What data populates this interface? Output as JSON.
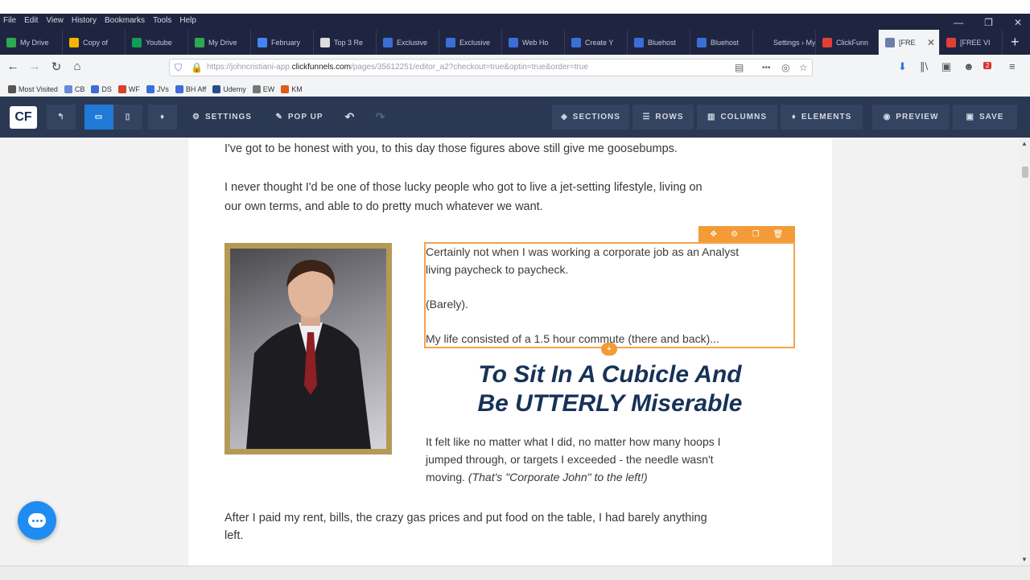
{
  "menu": [
    "File",
    "Edit",
    "View",
    "History",
    "Bookmarks",
    "Tools",
    "Help"
  ],
  "window_controls": [
    "—",
    "❐",
    "✕"
  ],
  "tabs": [
    {
      "label": "My Drive",
      "color": "#2fa84f"
    },
    {
      "label": "Copy of",
      "color": "#f4b400"
    },
    {
      "label": "Youtube",
      "color": "#0f9d58"
    },
    {
      "label": "My Drive",
      "color": "#2fa84f"
    },
    {
      "label": "February",
      "color": "#4285f4"
    },
    {
      "label": "Top 3 Re",
      "color": "#dddddd"
    },
    {
      "label": "Exclusive",
      "color": "#3b6fd8"
    },
    {
      "label": "Exclusive",
      "color": "#3b6fd8"
    },
    {
      "label": "Web Ho",
      "color": "#3b6fd8"
    },
    {
      "label": "Create Y",
      "color": "#3b6fd8"
    },
    {
      "label": "Bluehost",
      "color": "#3b6fd8"
    },
    {
      "label": "Bluehost",
      "color": "#3b6fd8"
    },
    {
      "label": "Settings › My",
      "color": "#1f2540"
    },
    {
      "label": "ClickFunn",
      "color": "#e0403a"
    },
    {
      "label": "[FRE",
      "color": "#6b7fa8",
      "active": true
    },
    {
      "label": "[FREE VI",
      "color": "#e0403a"
    }
  ],
  "tab_close": "✕",
  "tab_new": "+",
  "navbar": {
    "back": "←",
    "forward": "→",
    "reload": "↻",
    "home": "⌂",
    "url_prefix": "https://johncristiani-app.",
    "url_domain": "clickfunnels.com",
    "url_suffix": "/pages/35612251/editor_a2?checkout=true&optin=true&order=true",
    "reader": "▤",
    "more": "•••",
    "pocket": "◎",
    "star": "☆",
    "download": "⬇",
    "library": "∥\\",
    "sidebar": "▣",
    "account": "☻",
    "ext_badge": "2",
    "menu": "≡"
  },
  "bookmarks": [
    {
      "label": "Most Visited",
      "color": "#555555"
    },
    {
      "label": "CB",
      "color": "#6a8ad8"
    },
    {
      "label": "DS",
      "color": "#3c6ed8"
    },
    {
      "label": "WF",
      "color": "#d8402e"
    },
    {
      "label": "JVs",
      "color": "#3c6ed8"
    },
    {
      "label": "BH Aff",
      "color": "#3c6ed8"
    },
    {
      "label": "Udemy",
      "color": "#2c4c8a"
    },
    {
      "label": "EW",
      "color": "#777777"
    },
    {
      "label": "KM",
      "color": "#e05a1e"
    }
  ],
  "editor_toolbar": {
    "logo": "CF",
    "undo_back": "↰",
    "desktop_icon": "▭",
    "mobile_icon": "▯",
    "pin_icon": "♦",
    "settings": "SETTINGS",
    "popup": "POP UP",
    "undo": "↶",
    "redo": "↷",
    "sections": "SECTIONS",
    "rows": "ROWS",
    "columns": "COLUMNS",
    "elements": "ELEMENTS",
    "preview": "PREVIEW",
    "save": "SAVE"
  },
  "content": {
    "p1": "I've got to be honest with you, to this day those figures above still give me goosebumps.",
    "p2a": "I never thought I'd be one of those lucky people who got to live a jet-setting lifestyle, living on",
    "p2b": "our own terms, and able to do pretty much whatever we want.",
    "sel_line1": "Certainly not when I was working a corporate job as an Analyst",
    "sel_line2": "living paycheck to paycheck.",
    "sel_line3": "(Barely).",
    "sel_line4": "My life consisted of a 1.5 hour commute (there and back)...",
    "headline1": "To Sit In A Cubicle And",
    "headline2": "Be UTTERLY Miserable",
    "p3a": "It felt like no matter what I did, no matter how many hoops I",
    "p3b": "jumped through, or targets I exceeded - the needle wasn't",
    "p3c_plain": "moving. ",
    "p3c_italic": "(That's \"Corporate John\" to the left!)",
    "p4a": "After I paid my rent, bills, the crazy gas prices and put food on the table, I had barely anything",
    "p4b": "left."
  },
  "selection_tools": [
    "✥",
    "⚙",
    "❐",
    "🗑"
  ],
  "selection_handle": "+",
  "scrollbar": {
    "up": "▲",
    "down": "▼"
  }
}
